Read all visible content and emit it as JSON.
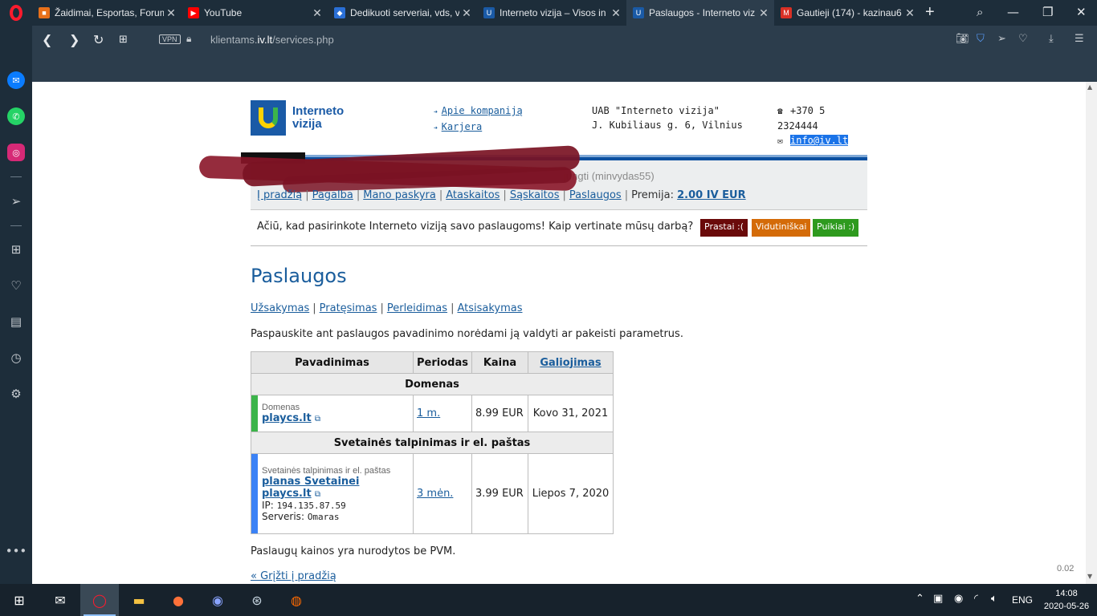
{
  "browser": {
    "tabs": [
      {
        "title": "Žaidimai, Esportas, Forum",
        "icon": "game-site-icon",
        "color": "#e8701a"
      },
      {
        "title": "YouTube",
        "icon": "youtube-icon",
        "color": "#ff0000"
      },
      {
        "title": "Dedikuoti serveriai, vds, v",
        "icon": "server-site-icon",
        "color": "#2a6fd6"
      },
      {
        "title": "Interneto vizija – Visos in",
        "icon": "iv-icon",
        "color": "#1a5aa6"
      },
      {
        "title": "Paslaugos - Interneto viz",
        "icon": "iv-icon",
        "color": "#1a5aa6"
      },
      {
        "title": "Gautieji (174) - kazinau6",
        "icon": "gmail-icon",
        "color": "#d93025"
      }
    ],
    "url_prefix": "klientams.",
    "url_domain": "iv.lt",
    "url_path": "/services.php",
    "vpn_label": "VPN"
  },
  "header": {
    "logo_line1": "Interneto",
    "logo_line2": "vizija",
    "link_about": "Apie kompaniją",
    "link_career": "Karjera",
    "company_name": "UAB \"Interneto vizija\"",
    "company_address": "J. Kubiliaus g. 6, Vilnius",
    "phone": "+370 5 2324444",
    "email": "info@iv.lt"
  },
  "user": {
    "login_text": "jungti (minvydas55)"
  },
  "menu": {
    "items": [
      "Į pradžią",
      "Pagalba",
      "Mano paskyra",
      "Ataskaitos",
      "Sąskaitos",
      "Paslaugos"
    ],
    "premium_label": "Premija:",
    "premium_value": "2.00 IV EUR"
  },
  "rating": {
    "question": "Ačiū, kad pasirinkote Interneto viziją savo paslaugoms! Kaip vertinate mūsų darbą?",
    "bad": "Prastai :(",
    "medium": "Vidutiniškai",
    "good": "Puikiai :)",
    "colors": {
      "bad": "#6a0a0a",
      "medium": "#d46b08",
      "good": "#2e9a1e"
    }
  },
  "page": {
    "title": "Paslaugos",
    "sublinks": [
      "Užsakymas",
      "Pratęsimas",
      "Perleidimas",
      "Atsisakymas"
    ],
    "hint": "Paspauskite ant paslaugos pavadinimo norėdami ją valdyti ar pakeisti parametrus.",
    "note": "Paslaugų kainos yra nurodytos be PVM.",
    "back_link": "« Grįžti į pradžią",
    "timing": "0.02"
  },
  "table": {
    "headers": [
      "Pavadinimas",
      "Periodas",
      "Kaina",
      "Galiojimas"
    ],
    "group1": "Domenas",
    "row1": {
      "type": "Domenas",
      "name": "playcs.lt",
      "period": "1 m.",
      "price": "8.99 EUR",
      "valid": "Kovo 31, 2021",
      "stripe": "#3cb44a"
    },
    "group2": "Svetainės talpinimas ir el. paštas",
    "row2": {
      "type": "Svetainės talpinimas ir el. paštas",
      "plan": "planas Svetainei",
      "name": "playcs.lt",
      "ip_label": "IP:",
      "ip": "194.135.87.59",
      "server_label": "Serveris:",
      "server": "Omaras",
      "period": "3 mėn.",
      "price": "3.99 EUR",
      "valid": "Liepos 7, 2020",
      "stripe": "#3b82f6"
    }
  },
  "taskbar": {
    "language": "ENG",
    "time": "14:08",
    "date": "2020-05-26"
  }
}
